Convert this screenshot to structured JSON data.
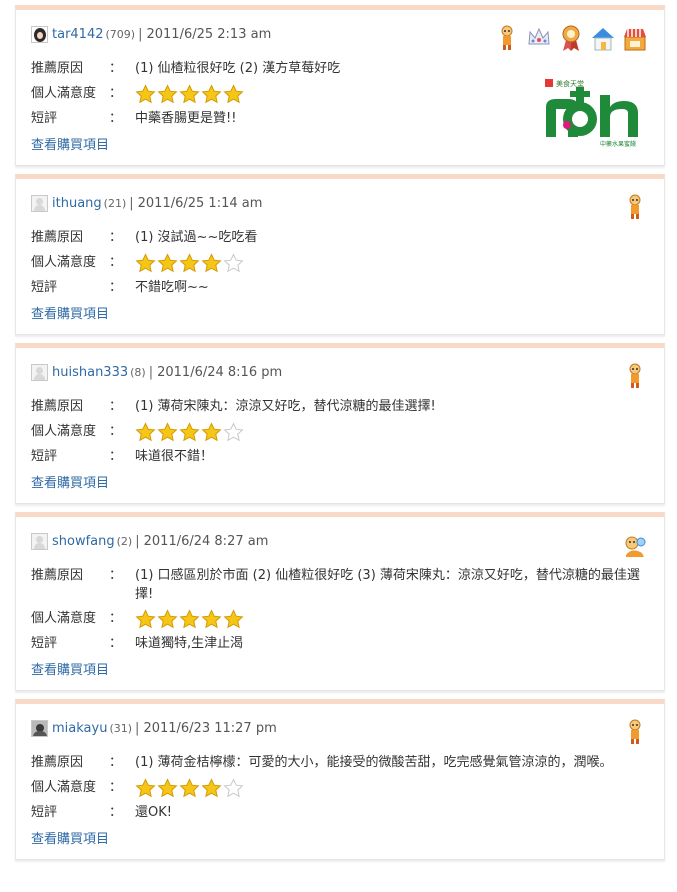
{
  "labels": {
    "reason": "推薦原因",
    "satisfaction": "個人滿意度",
    "comment": "短評",
    "colon": "：",
    "view_link": "查看購買項目",
    "separator": "|"
  },
  "colors": {
    "accent_border": "#f9d9c7",
    "link": "#2f6aa5",
    "star": "#f5c518"
  },
  "brand_logo": {
    "name": "nonon-logo",
    "small_text": "中藥水果蜜餞",
    "top_text": "美食天堂"
  },
  "reviews": [
    {
      "user": "tar4142",
      "count": "(709)",
      "date": "2011/6/25  2:13 am",
      "avatar": "girl-avatar",
      "badges": [
        "cook-badge-icon",
        "crown-badge-icon",
        "medal-badge-icon",
        "house-badge-icon",
        "shop-badge-icon"
      ],
      "reason": "(1) 仙楂粒很好吃   (2) 漢方草莓好吃",
      "rating": 5,
      "comment": "中藥香腸更是贊!!"
    },
    {
      "user": "ithuang",
      "count": "(21)",
      "date": "2011/6/25  1:14 am",
      "avatar": "default-avatar",
      "badges": [
        "cook-badge-icon"
      ],
      "reason": "(1) 沒試過~~吃吃看",
      "rating": 4,
      "comment": "不錯吃啊~~"
    },
    {
      "user": "huishan333",
      "count": "(8)",
      "date": "2011/6/24  8:16 pm",
      "avatar": "default-avatar",
      "badges": [
        "cook-badge-icon"
      ],
      "reason": "(1) 薄荷宋陳丸：涼涼又好吃，替代涼糖的最佳選擇!",
      "rating": 4,
      "comment": "味道很不錯！"
    },
    {
      "user": "showfang",
      "count": "(2)",
      "date": "2011/6/24  8:27 am",
      "avatar": "default-avatar",
      "badges": [
        "newbie-badge-icon"
      ],
      "reason": "(1) 口感區別於市面   (2) 仙楂粒很好吃   (3) 薄荷宋陳丸：涼涼又好吃，替代涼糖的最佳選擇!",
      "rating": 5,
      "comment": "味道獨特,生津止渴"
    },
    {
      "user": "miakayu",
      "count": "(31)",
      "date": "2011/6/23  11:27 pm",
      "avatar": "dark-avatar",
      "badges": [
        "cook-badge-icon"
      ],
      "reason": "(1) 薄荷金桔檸檬：可愛的大小，能接受的微酸苦甜，吃完感覺氣管涼涼的，潤喉。",
      "rating": 4,
      "comment": "還OK!"
    }
  ]
}
